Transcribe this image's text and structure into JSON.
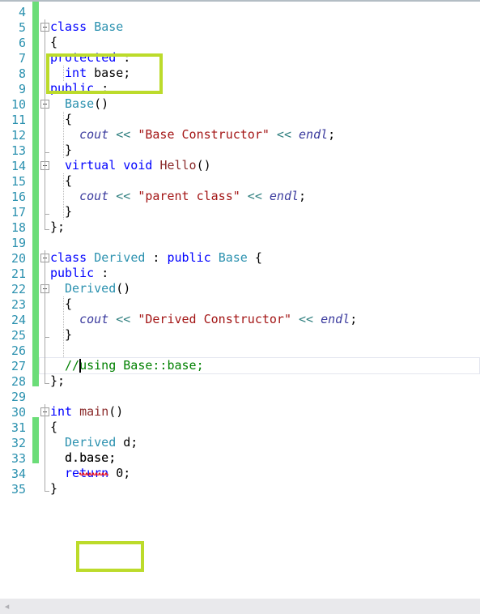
{
  "editor": {
    "app": "visual-studio-code-editor",
    "language": "C++",
    "first_visible_line": 4,
    "last_visible_line": 35,
    "line_height": 19,
    "colors": {
      "keyword": "#0000ff",
      "type": "#2b91af",
      "function": "#8b2b2b",
      "string": "#a31515",
      "comment": "#008000",
      "operator": "#2f7f7f",
      "std_member": "#3b3b9e",
      "line_number": "#2b91af",
      "change_bar": "#6bdd78",
      "annotation_box": "#bcdb2b",
      "error_squiggle": "#e81123",
      "background": "#ffffff",
      "scrollbar": "#e9e9ec"
    },
    "caret": {
      "line": 27,
      "column": 8
    },
    "current_line": 27
  },
  "lines": [
    {
      "n": 4,
      "indent": 0,
      "tokens": []
    },
    {
      "n": 5,
      "indent": 0,
      "tokens": [
        {
          "t": "class",
          "c": "kw"
        },
        {
          "t": " ",
          "c": "pl"
        },
        {
          "t": "Base",
          "c": "typ"
        }
      ]
    },
    {
      "n": 6,
      "indent": 0,
      "tokens": [
        {
          "t": "{",
          "c": "pl"
        }
      ]
    },
    {
      "n": 7,
      "indent": 0,
      "tokens": [
        {
          "t": "protected",
          "c": "kw"
        },
        {
          "t": " :",
          "c": "pl"
        }
      ]
    },
    {
      "n": 8,
      "indent": 1,
      "tokens": [
        {
          "t": "int",
          "c": "kw"
        },
        {
          "t": " base;",
          "c": "pl"
        }
      ]
    },
    {
      "n": 9,
      "indent": 0,
      "tokens": [
        {
          "t": "public",
          "c": "kw"
        },
        {
          "t": " :",
          "c": "pl"
        }
      ]
    },
    {
      "n": 10,
      "indent": 1,
      "tokens": [
        {
          "t": "Base",
          "c": "typ"
        },
        {
          "t": "()",
          "c": "pl"
        }
      ]
    },
    {
      "n": 11,
      "indent": 1,
      "tokens": [
        {
          "t": "{",
          "c": "pl"
        }
      ]
    },
    {
      "n": 12,
      "indent": 2,
      "tokens": [
        {
          "t": "cout",
          "c": "std"
        },
        {
          "t": " ",
          "c": "pl"
        },
        {
          "t": "<<",
          "c": "op"
        },
        {
          "t": " ",
          "c": "pl"
        },
        {
          "t": "\"Base Constructor\"",
          "c": "str"
        },
        {
          "t": " ",
          "c": "pl"
        },
        {
          "t": "<<",
          "c": "op"
        },
        {
          "t": " ",
          "c": "pl"
        },
        {
          "t": "endl",
          "c": "std"
        },
        {
          "t": ";",
          "c": "pl"
        }
      ]
    },
    {
      "n": 13,
      "indent": 1,
      "tokens": [
        {
          "t": "}",
          "c": "pl"
        }
      ]
    },
    {
      "n": 14,
      "indent": 1,
      "tokens": [
        {
          "t": "virtual",
          "c": "kw"
        },
        {
          "t": " ",
          "c": "pl"
        },
        {
          "t": "void",
          "c": "kw"
        },
        {
          "t": " ",
          "c": "pl"
        },
        {
          "t": "Hello",
          "c": "fn"
        },
        {
          "t": "()",
          "c": "pl"
        }
      ]
    },
    {
      "n": 15,
      "indent": 1,
      "tokens": [
        {
          "t": "{",
          "c": "pl"
        }
      ]
    },
    {
      "n": 16,
      "indent": 2,
      "tokens": [
        {
          "t": "cout",
          "c": "std"
        },
        {
          "t": " ",
          "c": "pl"
        },
        {
          "t": "<<",
          "c": "op"
        },
        {
          "t": " ",
          "c": "pl"
        },
        {
          "t": "\"parent class\"",
          "c": "str"
        },
        {
          "t": " ",
          "c": "pl"
        },
        {
          "t": "<<",
          "c": "op"
        },
        {
          "t": " ",
          "c": "pl"
        },
        {
          "t": "endl",
          "c": "std"
        },
        {
          "t": ";",
          "c": "pl"
        }
      ]
    },
    {
      "n": 17,
      "indent": 1,
      "tokens": [
        {
          "t": "}",
          "c": "pl"
        }
      ]
    },
    {
      "n": 18,
      "indent": 0,
      "tokens": [
        {
          "t": "};",
          "c": "pl"
        }
      ]
    },
    {
      "n": 19,
      "indent": 0,
      "tokens": []
    },
    {
      "n": 20,
      "indent": 0,
      "tokens": [
        {
          "t": "class",
          "c": "kw"
        },
        {
          "t": " ",
          "c": "pl"
        },
        {
          "t": "Derived",
          "c": "typ"
        },
        {
          "t": " : ",
          "c": "pl"
        },
        {
          "t": "public",
          "c": "kw"
        },
        {
          "t": " ",
          "c": "pl"
        },
        {
          "t": "Base",
          "c": "typ"
        },
        {
          "t": " {",
          "c": "pl"
        }
      ]
    },
    {
      "n": 21,
      "indent": 0,
      "tokens": [
        {
          "t": "public",
          "c": "kw"
        },
        {
          "t": " :",
          "c": "pl"
        }
      ]
    },
    {
      "n": 22,
      "indent": 1,
      "tokens": [
        {
          "t": "Derived",
          "c": "typ"
        },
        {
          "t": "()",
          "c": "pl"
        }
      ]
    },
    {
      "n": 23,
      "indent": 1,
      "tokens": [
        {
          "t": "{",
          "c": "pl"
        }
      ]
    },
    {
      "n": 24,
      "indent": 2,
      "tokens": [
        {
          "t": "cout",
          "c": "std"
        },
        {
          "t": " ",
          "c": "pl"
        },
        {
          "t": "<<",
          "c": "op"
        },
        {
          "t": " ",
          "c": "pl"
        },
        {
          "t": "\"Derived Constructor\"",
          "c": "str"
        },
        {
          "t": " ",
          "c": "pl"
        },
        {
          "t": "<<",
          "c": "op"
        },
        {
          "t": " ",
          "c": "pl"
        },
        {
          "t": "endl",
          "c": "std"
        },
        {
          "t": ";",
          "c": "pl"
        }
      ]
    },
    {
      "n": 25,
      "indent": 1,
      "tokens": [
        {
          "t": "}",
          "c": "pl"
        }
      ]
    },
    {
      "n": 26,
      "indent": 0,
      "tokens": []
    },
    {
      "n": 27,
      "indent": 1,
      "tokens": [
        {
          "t": "//using Base::base;",
          "c": "cmt"
        }
      ]
    },
    {
      "n": 28,
      "indent": 0,
      "tokens": [
        {
          "t": "};",
          "c": "pl"
        }
      ]
    },
    {
      "n": 29,
      "indent": 0,
      "tokens": []
    },
    {
      "n": 30,
      "indent": 0,
      "tokens": [
        {
          "t": "int",
          "c": "kw"
        },
        {
          "t": " ",
          "c": "pl"
        },
        {
          "t": "main",
          "c": "fn"
        },
        {
          "t": "()",
          "c": "pl"
        }
      ]
    },
    {
      "n": 31,
      "indent": 0,
      "tokens": [
        {
          "t": "{",
          "c": "pl"
        }
      ]
    },
    {
      "n": 32,
      "indent": 1,
      "tokens": [
        {
          "t": "Derived",
          "c": "typ"
        },
        {
          "t": " d;",
          "c": "pl"
        }
      ]
    },
    {
      "n": 33,
      "indent": 1,
      "tokens": [
        {
          "t": "d.base;",
          "c": "pl"
        }
      ]
    },
    {
      "n": 34,
      "indent": 1,
      "tokens": [
        {
          "t": "return",
          "c": "kw"
        },
        {
          "t": " ",
          "c": "pl"
        },
        {
          "t": "0",
          "c": "num"
        },
        {
          "t": ";",
          "c": "pl"
        }
      ]
    },
    {
      "n": 35,
      "indent": 0,
      "tokens": [
        {
          "t": "}",
          "c": "pl"
        }
      ]
    }
  ],
  "change_bars": [
    {
      "from_line": 4,
      "to_line": 28
    },
    {
      "from_line": 31,
      "to_line": 33
    }
  ],
  "fold_markers": [
    {
      "line": 5,
      "state": "expanded"
    },
    {
      "line": 10,
      "state": "expanded"
    },
    {
      "line": 14,
      "state": "expanded"
    },
    {
      "line": 20,
      "state": "expanded"
    },
    {
      "line": 22,
      "state": "expanded"
    },
    {
      "line": 30,
      "state": "expanded"
    }
  ],
  "annotations": [
    {
      "label": "highlight-box-protected-base",
      "line_start": 7,
      "line_end": 8
    },
    {
      "label": "highlight-box-d-base",
      "line_start": 33,
      "line_end": 33
    }
  ],
  "errors": [
    {
      "line": 33,
      "text": "base",
      "kind": "squiggle-error"
    }
  ],
  "scrollbar": {
    "orientation": "horizontal",
    "left_arrow": "◂"
  }
}
